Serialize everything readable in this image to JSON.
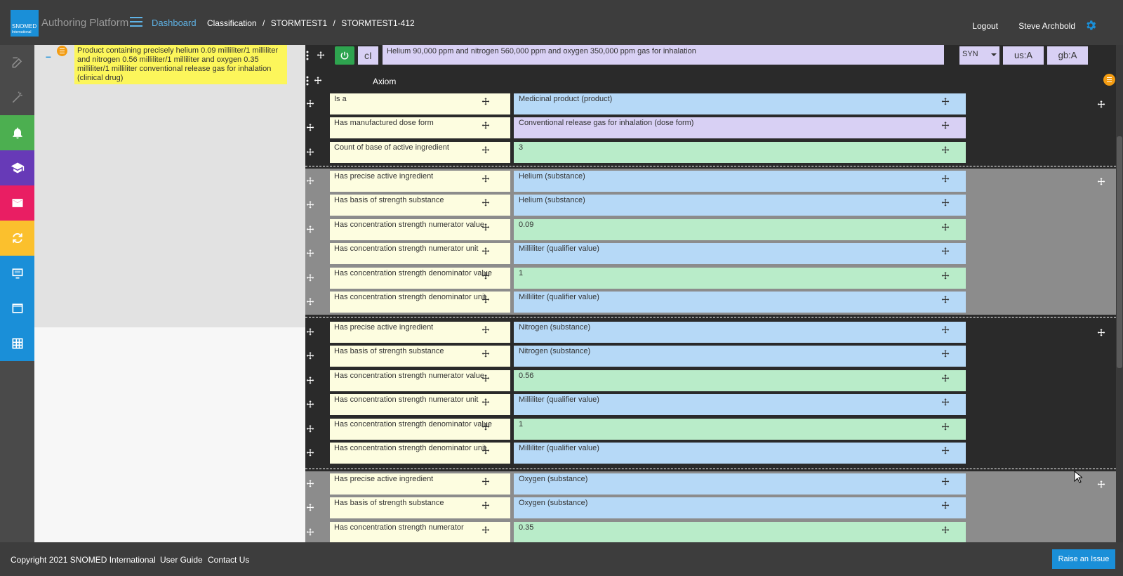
{
  "header": {
    "logo_text": "SNOMED",
    "logo_sub": "International",
    "app_title": "Authoring Platform",
    "breadcrumbs": {
      "dashboard": "Dashboard",
      "classification": "Classification",
      "project": "STORMTEST1",
      "task": "STORMTEST1-412"
    },
    "logout": "Logout",
    "user": "Steve Archbold"
  },
  "toolbar": {
    "items": [
      {
        "icon": "edit-icon",
        "color": "#4a4a4a"
      },
      {
        "icon": "wand-icon",
        "color": "#4a4a4a"
      },
      {
        "icon": "bell-icon",
        "color": "#4caf50"
      },
      {
        "icon": "graduation-cap-icon",
        "color": "#673ab7"
      },
      {
        "icon": "envelope-icon",
        "color": "#e91e63"
      },
      {
        "icon": "sync-icon",
        "color": "#fbc02d"
      },
      {
        "icon": "monitor-icon",
        "color": "#1a8fd8"
      },
      {
        "icon": "browser-icon",
        "color": "#1a8fd8"
      },
      {
        "icon": "grid-icon",
        "color": "#1a8fd8"
      }
    ]
  },
  "taxonomy": {
    "concept": "Product containing precisely helium 0.09 milliliter/1 milliliter and nitrogen 0.56 milliliter/1 milliliter and oxygen 0.35 milliliter/1 milliliter conventional release gas for inhalation (clinical drug)"
  },
  "description": {
    "case": "cI",
    "term": "Helium 90,000 ppm and nitrogen 560,000 ppm and oxygen 350,000 ppm gas for inhalation",
    "type": "SYN",
    "us": "us:A",
    "gb": "gb:A"
  },
  "axiom": {
    "label": "Axiom",
    "ungrouped": [
      {
        "type": "Is a",
        "target": "Medicinal product (product)",
        "color": "blue"
      },
      {
        "type": "Has manufactured dose form",
        "target": "Conventional release gas for inhalation (dose form)",
        "color": "purple"
      },
      {
        "type": "Count of base of active ingredient",
        "target": "3",
        "color": "green"
      }
    ],
    "group1": [
      {
        "type": "Has precise active ingredient",
        "target": "Helium (substance)",
        "color": "blue"
      },
      {
        "type": "Has basis of strength substance",
        "target": "Helium (substance)",
        "color": "blue"
      },
      {
        "type": "Has concentration strength numerator value",
        "target": "0.09",
        "color": "green"
      },
      {
        "type": "Has concentration strength numerator unit",
        "target": "Milliliter (qualifier value)",
        "color": "blue"
      },
      {
        "type": "Has concentration strength denominator value",
        "target": "1",
        "color": "green"
      },
      {
        "type": "Has concentration strength denominator unit",
        "target": "Milliliter (qualifier value)",
        "color": "blue"
      }
    ],
    "group2": [
      {
        "type": "Has precise active ingredient",
        "target": "Nitrogen (substance)",
        "color": "blue"
      },
      {
        "type": "Has basis of strength substance",
        "target": "Nitrogen (substance)",
        "color": "blue"
      },
      {
        "type": "Has concentration strength numerator value",
        "target": "0.56",
        "color": "green"
      },
      {
        "type": "Has concentration strength numerator unit",
        "target": "Milliliter (qualifier value)",
        "color": "blue"
      },
      {
        "type": "Has concentration strength denominator value",
        "target": "1",
        "color": "green"
      },
      {
        "type": "Has concentration strength denominator unit",
        "target": "Milliliter (qualifier value)",
        "color": "blue"
      }
    ],
    "group3": [
      {
        "type": "Has precise active ingredient",
        "target": "Oxygen (substance)",
        "color": "blue"
      },
      {
        "type": "Has basis of strength substance",
        "target": "Oxygen (substance)",
        "color": "blue"
      },
      {
        "type": "Has concentration strength numerator",
        "target": "0.35",
        "color": "green"
      }
    ]
  },
  "footer": {
    "copyright": "Copyright 2021 SNOMED International",
    "user_guide": "User Guide",
    "contact": "Contact Us",
    "raise_issue": "Raise an Issue"
  }
}
